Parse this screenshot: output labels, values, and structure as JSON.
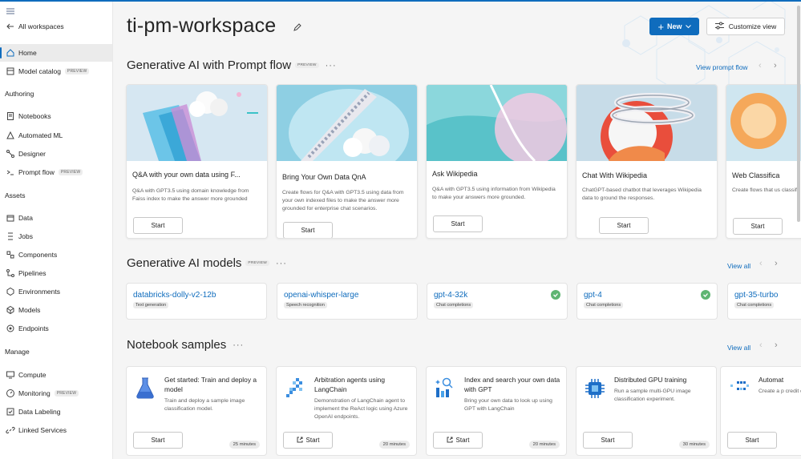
{
  "sidebar": {
    "all_workspaces": "All workspaces",
    "home": "Home",
    "model_catalog": "Model catalog",
    "preview": "PREVIEW",
    "authoring": "Authoring",
    "notebooks": "Notebooks",
    "automated_ml": "Automated ML",
    "designer": "Designer",
    "prompt_flow": "Prompt flow",
    "assets": "Assets",
    "data": "Data",
    "jobs": "Jobs",
    "components": "Components",
    "pipelines": "Pipelines",
    "environments": "Environments",
    "models": "Models",
    "endpoints": "Endpoints",
    "manage": "Manage",
    "compute": "Compute",
    "monitoring": "Monitoring",
    "data_labeling": "Data Labeling",
    "linked_services": "Linked Services"
  },
  "header": {
    "workspace_name": "ti-pm-workspace",
    "new_label": "New",
    "customize_label": "Customize view"
  },
  "prompt_flow_section": {
    "title": "Generative AI with Prompt flow",
    "badge": "PREVIEW",
    "view_link": "View prompt flow",
    "cards": [
      {
        "title": "Q&A with your own data using F...",
        "desc": "Q&A with GPT3.5 using domain knowledge from Faiss index to make the answer more grounded",
        "start": "Start"
      },
      {
        "title": "Bring Your Own Data QnA",
        "desc": "Create flows for Q&A with GPT3.5 using data from your own indexed files to make the answer more grounded for enterprise chat scenarios.",
        "start": "Start"
      },
      {
        "title": "Ask Wikipedia",
        "desc": "Q&A with GPT3.5 using information from Wikipedia to make your answers more grounded.",
        "start": "Start"
      },
      {
        "title": "Chat With Wikipedia",
        "desc": "ChatGPT-based chatbot that leverages Wikipedia data to ground the responses.",
        "start": "Start"
      },
      {
        "title": "Web Classifica",
        "desc": "Create flows that us classify URLs into m",
        "start": "Start"
      }
    ]
  },
  "models_section": {
    "title": "Generative AI models",
    "badge": "PREVIEW",
    "view_all": "View all",
    "cards": [
      {
        "name": "databricks-dolly-v2-12b",
        "tag": "Text generation"
      },
      {
        "name": "openai-whisper-large",
        "tag": "Speech recognition"
      },
      {
        "name": "gpt-4-32k",
        "tag": "Chat completions"
      },
      {
        "name": "gpt-4",
        "tag": "Chat completions"
      },
      {
        "name": "gpt-35-turbo",
        "tag": "Chat completions"
      }
    ]
  },
  "notebook_section": {
    "title": "Notebook samples",
    "view_all": "View all",
    "cards": [
      {
        "title": "Get started: Train and deploy a model",
        "desc": "Train and deploy a sample image classification model.",
        "duration": "25 minutes",
        "start": "Start"
      },
      {
        "title": "Arbitration agents using LangChain",
        "desc": "Demonstration of LangChain agent to implement the ReAct logic using Azure OpenAI endpoints.",
        "duration": "20 minutes",
        "start": "Start"
      },
      {
        "title": "Index and search your own data with GPT",
        "desc": "Bring your own data to look up using GPT with LangChain",
        "duration": "20 minutes",
        "start": "Start"
      },
      {
        "title": "Distributed GPU training",
        "desc": "Run a sample multi-GPU image classification experiment.",
        "duration": "30 minutes",
        "start": "Start"
      },
      {
        "title": "Automat",
        "desc": "Create a p credit defa",
        "duration": "",
        "start": "Start"
      }
    ]
  },
  "colors": {
    "accent": "#0f6cbd",
    "check": "#5fb572"
  }
}
